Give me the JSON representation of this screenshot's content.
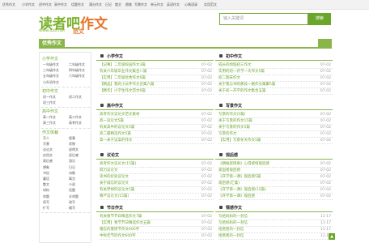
{
  "topnav": [
    "优秀作文",
    "小学作文",
    "初中作文",
    "高中作文",
    "话题作文",
    "满分作文",
    "日记",
    "散文",
    "随笔",
    "写景作文",
    "单元作文",
    "英语作文",
    "心情语录",
    "实用范文"
  ],
  "logo": {
    "main_a": "读者吧",
    "main_b": "作文",
    "url": "www.dz8.net",
    "sub": "范文"
  },
  "search": {
    "placeholder": "输入关键词",
    "button": "搜索"
  },
  "section_title": "优秀作文",
  "sidebar": {
    "groups": [
      {
        "title": "小学作文",
        "items": [
          "一年级作文",
          "二年级作文",
          "三年级作文",
          "四年级作文",
          "五年级作文",
          "六年级作文",
          "小升初作文"
        ]
      },
      {
        "title": "初中作文",
        "items": [
          "初一作文",
          "初二作文",
          "初三作文"
        ]
      },
      {
        "title": "高中作文",
        "items": [
          "高一作文",
          "高二作文",
          "高三作文",
          "高考作文"
        ]
      },
      {
        "title": "作文体裁",
        "items": [
          "写人",
          "叙事",
          "写景",
          "状物",
          "议论文",
          "说明文",
          "应用文",
          "读后感",
          "观后感",
          "游记",
          "想象",
          "日记",
          "书信",
          "诗歌",
          "童话",
          "寓言",
          "散文",
          "小说",
          "材料",
          "话题",
          "命题",
          "半命题",
          "续写",
          "改写",
          "扩写",
          "缩写"
        ]
      }
    ]
  },
  "panels": [
    {
      "title": "小学作文",
      "rows": [
        {
          "text": "【记事】二年级校园作文3篇",
          "date": "07-02"
        },
        {
          "text": "有关六年级毕业作文集合八篇",
          "date": "07-02"
        },
        {
          "text": "【实用】二年级优秀作文6篇",
          "date": "07-02"
        },
        {
          "text": "【精品】我的小伙伴作文合集六篇",
          "date": "07-02"
        },
        {
          "text": "【精华】小学生作文范文6篇",
          "date": "07-02"
        }
      ]
    },
    {
      "title": "初中作文",
      "rows": [
        {
          "text": "成长的烦恼初三作文",
          "date": "07-02"
        },
        {
          "text": "实用的初一开学一天作文5篇",
          "date": "07-02"
        },
        {
          "text": "初二期末作文",
          "date": "07-02"
        },
        {
          "text": "关于我与书的那段一路作文集聚5篇",
          "date": "07-02"
        },
        {
          "text": "关于初一开学的作文集合五篇",
          "date": "07-02"
        }
      ]
    },
    {
      "title": "高中作文",
      "rows": [
        {
          "text": "高考作文议论文范文素材",
          "date": "07-02"
        },
        {
          "text": "高一议论文5篇",
          "date": "07-02"
        },
        {
          "text": "有关高中的议论文5篇",
          "date": "07-02"
        },
        {
          "text": "高二最精选作文5篇",
          "date": "07-02"
        },
        {
          "text": "高一关于议案的作文",
          "date": "07-02"
        }
      ]
    },
    {
      "title": "写景作文",
      "rows": [
        {
          "text": "写景的作文(5篇)",
          "date": "07-02"
        },
        {
          "text": "关于写景的作文15篇",
          "date": "07-02"
        },
        {
          "text": "关于写景的作文5篇",
          "date": "07-02"
        },
        {
          "text": "写景的作文",
          "date": "07-02"
        },
        {
          "text": "【实用】写景冬天作文5篇",
          "date": "07-02"
        }
      ]
    },
    {
      "title": "议论文",
      "rows": [
        {
          "text": "高考作文议论文(15篇)",
          "date": "07-02"
        },
        {
          "text": "努力议论文",
          "date": "07-02"
        },
        {
          "text": "读书的好处议论文",
          "date": "07-02"
        },
        {
          "text": "关于诚信的议论文",
          "date": "07-02"
        },
        {
          "text": "有关梦想的议论文5篇",
          "date": "07-02"
        },
        {
          "text": "尊严议论文(15篇)",
          "date": "07-02"
        }
      ]
    },
    {
      "title": "观后感",
      "rows": [
        {
          "text": "《朝拍案惊奇》心得感悟观后感",
          "date": "07-02"
        },
        {
          "text": "爱国者观后感",
          "date": "07-02"
        },
        {
          "text": "《开学第一课》观后感5篇",
          "date": "07-02"
        },
        {
          "text": "观后感(汇集)",
          "date": "07-02"
        },
        {
          "text": "《开学第一课》观后感(15篇)",
          "date": "07-02"
        },
        {
          "text": "《开学第一课》观后感",
          "date": "07-02"
        }
      ]
    },
    {
      "title": "节日作文",
      "rows": [
        {
          "text": "有关春节节日精选作文7篇",
          "date": "07-02"
        },
        {
          "text": "【实用】春节节日精选作文五篇",
          "date": "07-02"
        },
        {
          "text": "难忘的重阳节作文600字",
          "date": "07-02"
        },
        {
          "text": "中秋佳节的作文600字",
          "date": "07-02"
        }
      ]
    },
    {
      "title": "情感作文",
      "rows": [
        {
          "text": "写给妈妈的一封信",
          "date": "11-17"
        },
        {
          "text": "写给妈妈的一封信",
          "date": "11-17"
        },
        {
          "text": "给爸爸的一封信",
          "date": "11-17"
        },
        {
          "text": "给爸爸的一封信",
          "date": "11-17"
        }
      ]
    }
  ],
  "back_to_top": "▲"
}
